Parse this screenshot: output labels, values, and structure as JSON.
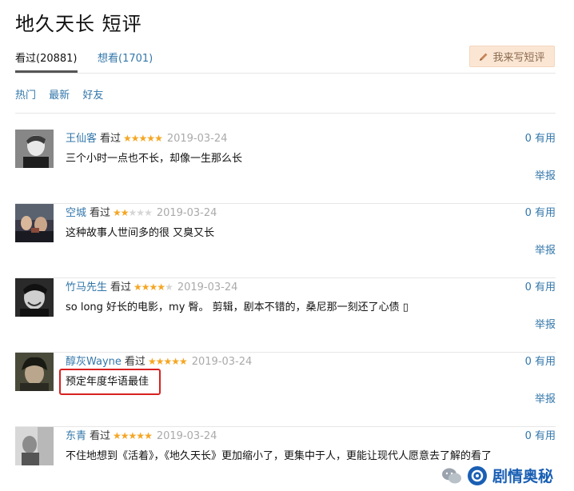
{
  "page": {
    "title": "地久天长 短评"
  },
  "tabs": [
    {
      "label": "看过(20881)",
      "active": true
    },
    {
      "label": "想看(1701)",
      "active": false
    }
  ],
  "write_button": {
    "label": "我来写短评",
    "icon": "pencil-icon"
  },
  "filters": [
    "热门",
    "最新",
    "好友"
  ],
  "colors": {
    "link": "#3377aa",
    "star": "#f5a623",
    "highlight": "#d92020",
    "button_bg": "#fbe6d4"
  },
  "comments": [
    {
      "user": "王仙客",
      "status": "看过",
      "rating": 5,
      "date": "2019-03-24",
      "useful": "0 有用",
      "content": "三个小时一点也不长，却像一生那么长",
      "report": "举报"
    },
    {
      "user": "空城",
      "status": "看过",
      "rating": 2,
      "date": "2019-03-24",
      "useful": "0 有用",
      "content": "这种故事人世间多的很 又臭又长",
      "report": "举报"
    },
    {
      "user": "竹马先生",
      "status": "看过",
      "rating": 4,
      "date": "2019-03-24",
      "useful": "0 有用",
      "content": "so long 好长的电影，my 臀。 剪辑，剧本不错的，桑尼那一刻还了心债 ▯",
      "report": "举报"
    },
    {
      "user": "醇灰Wayne",
      "status": "看过",
      "rating": 5,
      "date": "2019-03-24",
      "useful": "0 有用",
      "content": "预定年度华语最佳",
      "report": "举报",
      "highlighted": true
    },
    {
      "user": "东青",
      "status": "看过",
      "rating": 5,
      "date": "2019-03-24",
      "useful": "0 有用",
      "content": "不住地想到《活着》，《地久天长》更加缩小了，更集中于人，更能让现代人愿意去了解的看了"
    }
  ],
  "watermark": {
    "text": "剧情奥秘"
  }
}
